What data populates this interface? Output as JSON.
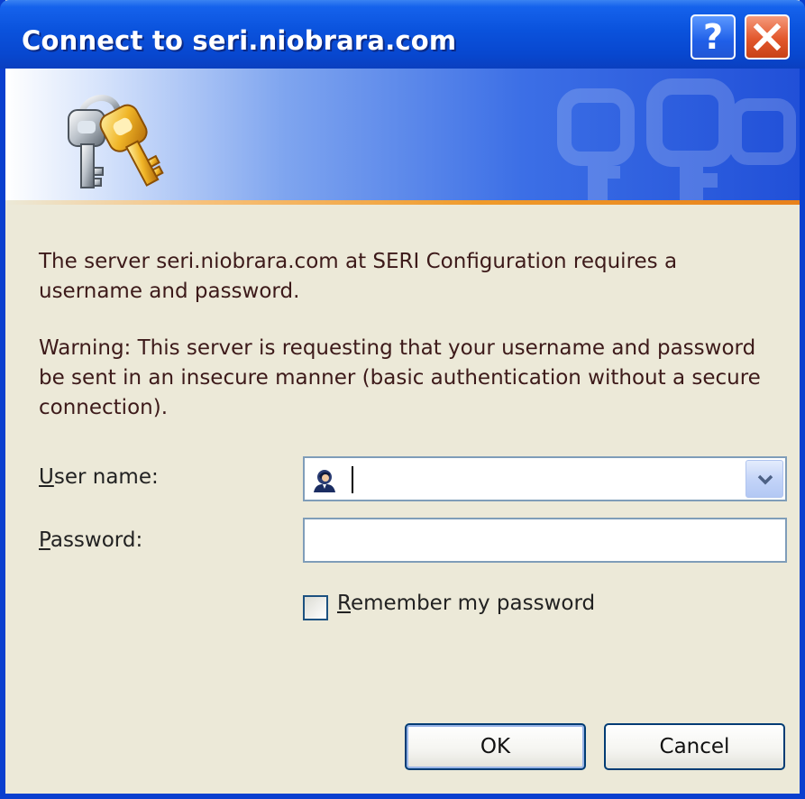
{
  "window": {
    "title": "Connect to seri.niobrara.com",
    "help_label": "?",
    "icons": [
      "keys-icon",
      "help-icon",
      "close-icon",
      "user-icon",
      "chevron-down-icon"
    ]
  },
  "content": {
    "message": "The server seri.niobrara.com at SERI Configuration requires a username and password.",
    "warning": "Warning: This server is requesting that your username and password be sent in an insecure manner (basic authentication without a secure connection)."
  },
  "form": {
    "username_label_accel": "U",
    "username_label_rest": "ser name:",
    "username_value": "",
    "password_label_accel": "P",
    "password_label_rest": "assword:",
    "password_value": "",
    "remember_accel": "R",
    "remember_rest": "emember my password",
    "remember_checked": false
  },
  "buttons": {
    "ok": "OK",
    "cancel": "Cancel"
  },
  "colors": {
    "titlebar": "#0a52dc",
    "dialog_bg": "#ece9d8",
    "text": "#3d1a1a",
    "accent_orange": "#ef9a2a"
  }
}
